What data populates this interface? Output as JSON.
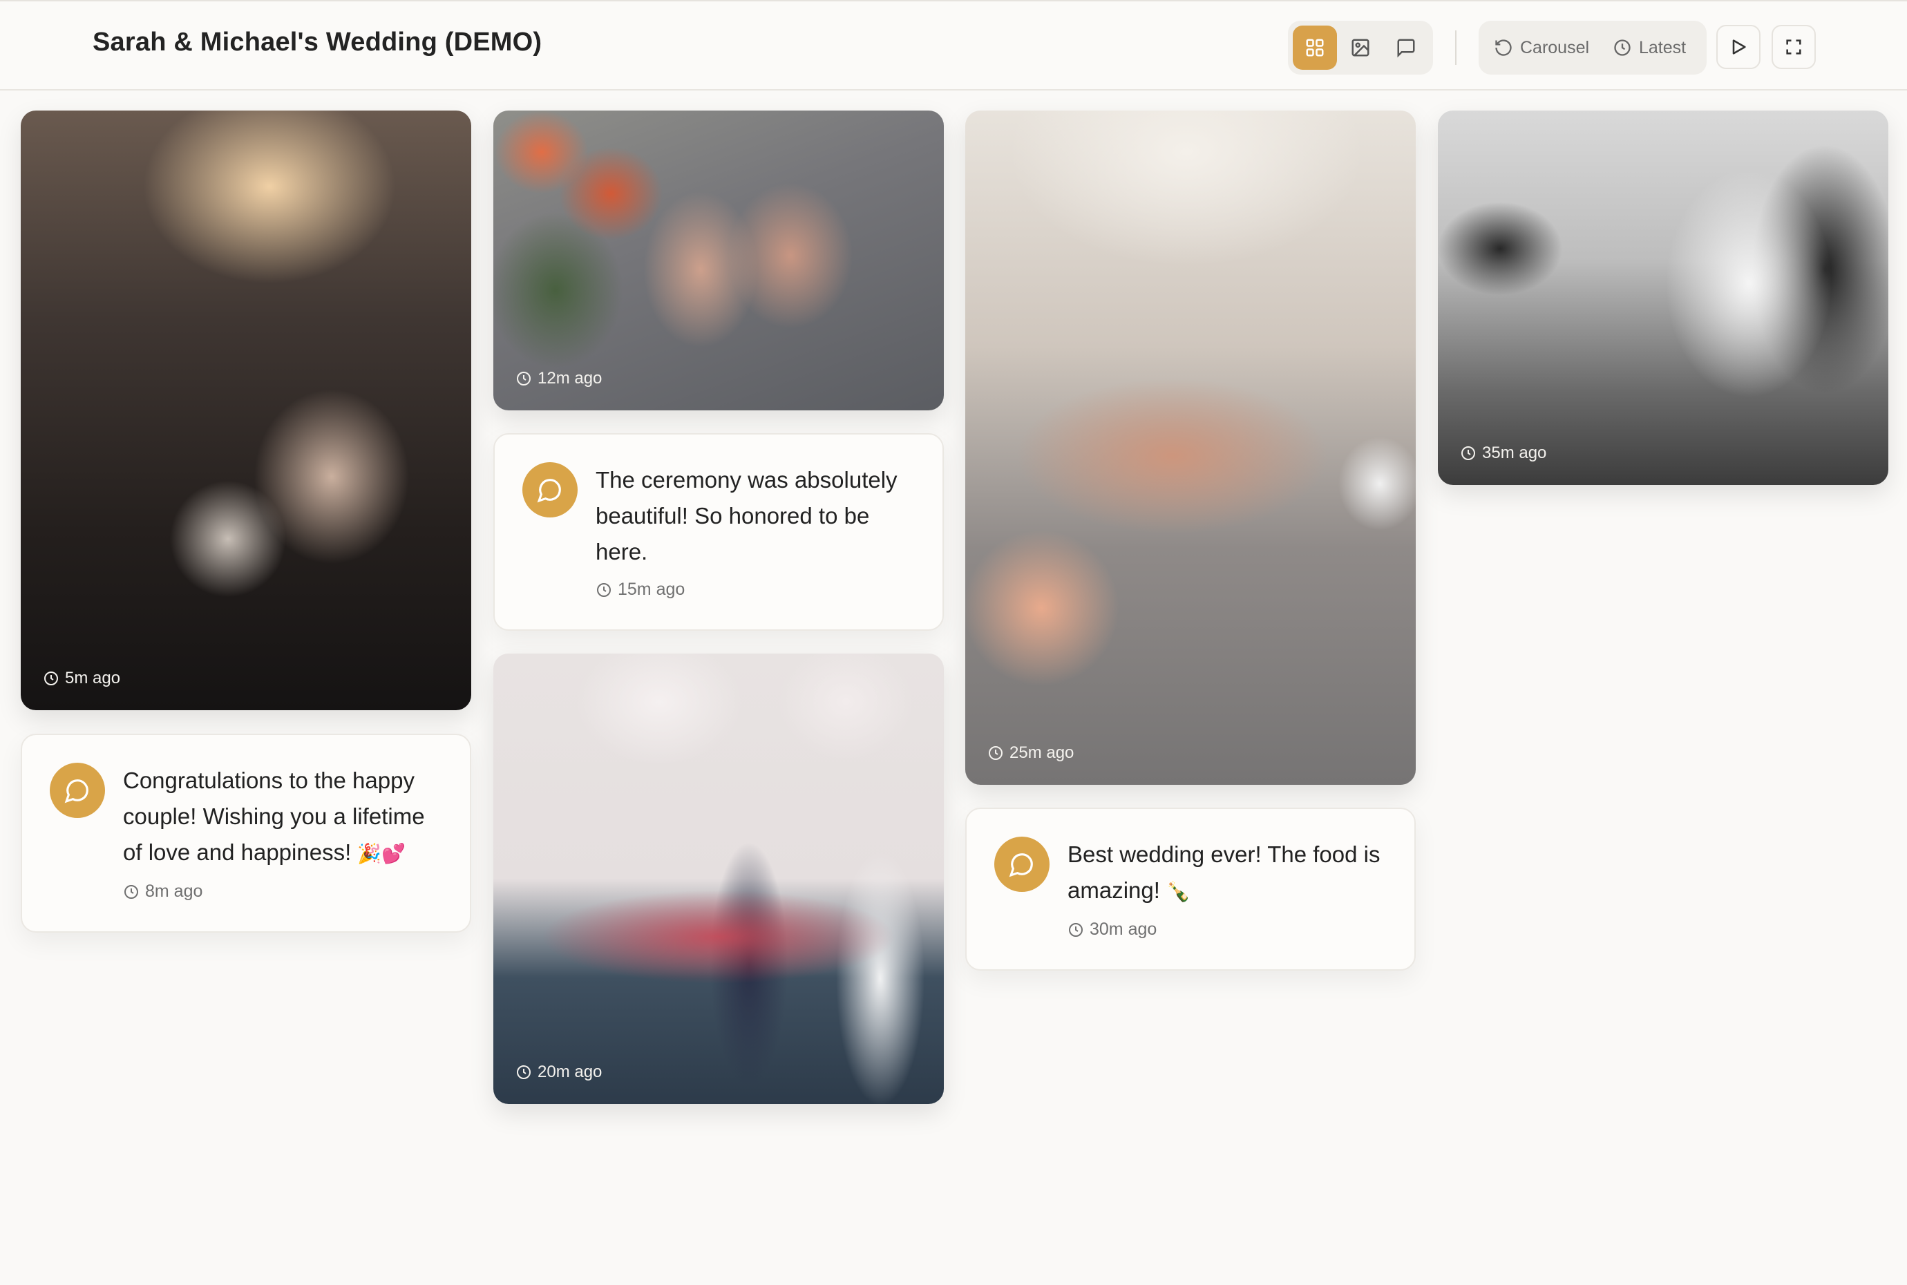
{
  "header": {
    "title": "Sarah & Michael's Wedding (DEMO)",
    "views": [
      {
        "name": "grid",
        "icon": "grid-icon",
        "active": true
      },
      {
        "name": "photos",
        "icon": "image-icon",
        "active": false
      },
      {
        "name": "messages",
        "icon": "message-icon",
        "active": false
      }
    ],
    "carousel_label": "Carousel",
    "latest_label": "Latest",
    "play_icon": "play-icon",
    "fullscreen_icon": "fullscreen-icon"
  },
  "colors": {
    "accent": "#d8a14a",
    "background": "#faf9f7",
    "card_border": "#ebe8e3"
  },
  "feed": {
    "photo_1": {
      "time": "5m ago",
      "subject": "bride holding bouquet with groom"
    },
    "message_1": {
      "text": "Congratulations to the happy couple! Wishing you a lifetime of love and happiness!",
      "emoji": "🎉💕",
      "time": "8m ago"
    },
    "photo_2": {
      "time": "12m ago",
      "subject": "hands with wedding rings and flowers"
    },
    "message_2": {
      "text": "The ceremony was absolutely beautiful! So honored to be here.",
      "time": "15m ago"
    },
    "photo_3": {
      "time": "20m ago",
      "subject": "couple releasing balloons by pool"
    },
    "photo_4": {
      "time": "25m ago",
      "subject": "hands with ring and watch"
    },
    "message_3": {
      "text": "Best wedding ever! The food is amazing!",
      "emoji": "🍾",
      "time": "30m ago"
    },
    "photo_5": {
      "time": "35m ago",
      "subject": "black and white couple kissing with veil"
    }
  }
}
